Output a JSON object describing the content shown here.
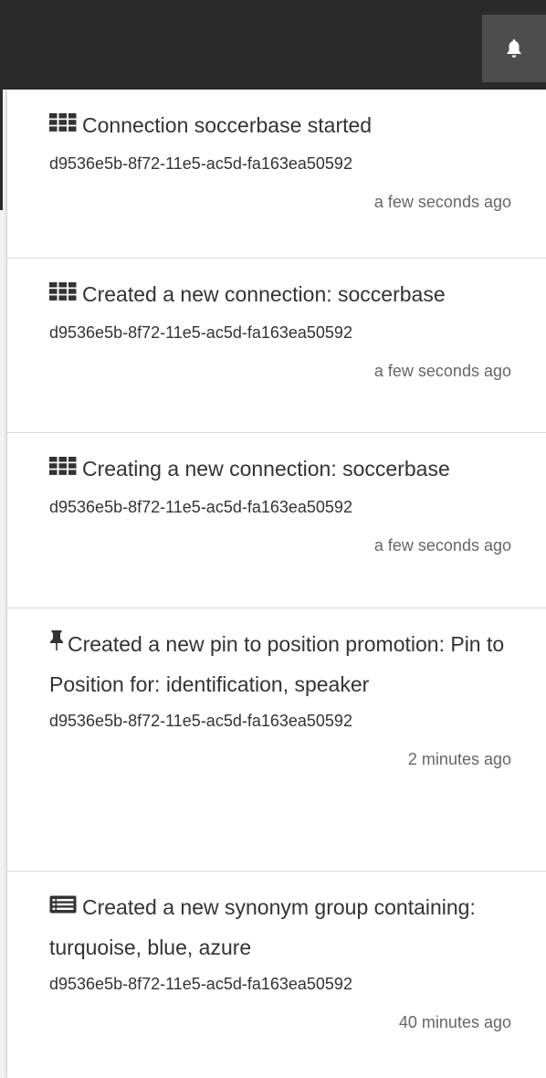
{
  "header": {
    "bell_icon": "bell-icon"
  },
  "notifications": [
    {
      "icon": "grid-icon",
      "message": "Connection soccerbase started",
      "id": "d9536e5b-8f72-11e5-ac5d-fa163ea50592",
      "time": "a few seconds ago"
    },
    {
      "icon": "grid-icon",
      "message": "Created a new connection: soccerbase",
      "id": "d9536e5b-8f72-11e5-ac5d-fa163ea50592",
      "time": "a few seconds ago"
    },
    {
      "icon": "grid-icon",
      "message": "Creating a new connection: soccerbase",
      "id": "d9536e5b-8f72-11e5-ac5d-fa163ea50592",
      "time": "a few seconds ago"
    },
    {
      "icon": "pin-icon",
      "message": "Created a new pin to position promotion: Pin to Position for: identification, speaker",
      "id": "d9536e5b-8f72-11e5-ac5d-fa163ea50592",
      "time": "2 minutes ago"
    },
    {
      "icon": "list-icon",
      "message": "Created a new synonym group containing: turquoise, blue, azure",
      "id": "d9536e5b-8f72-11e5-ac5d-fa163ea50592",
      "time": "40 minutes ago"
    }
  ]
}
